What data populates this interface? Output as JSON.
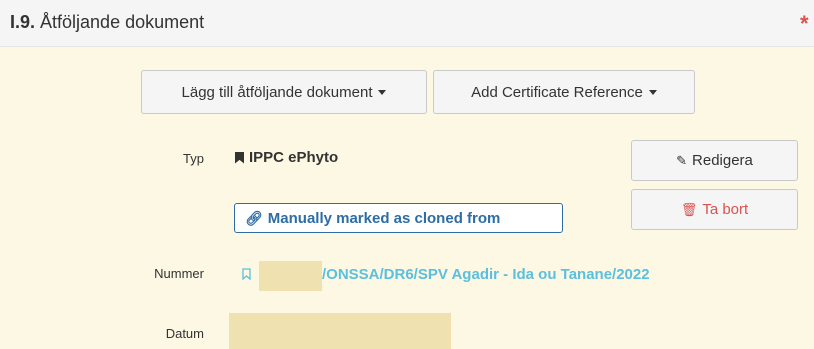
{
  "header": {
    "section_number": "I.9.",
    "section_title": " Åtföljande dokument",
    "required_marker": "*"
  },
  "toolbar": {
    "add_document_label": "Lägg till åtföljande dokument",
    "add_certificate_label": "Add Certificate Reference"
  },
  "document": {
    "type_label": "Typ",
    "type_value": "IPPC ePhyto",
    "cloned_badge": "Manually marked as cloned from",
    "edit_label": "Redigera",
    "delete_label": "Ta bort",
    "number_label": "Nummer",
    "number_value": "/ONSSA/DR6/SPV Agadir - Ida ou Tanane/2022",
    "date_label": "Datum"
  },
  "colors": {
    "panel_body": "#fcf8e3",
    "link": "#5bc0de",
    "badge": "#2e6da4",
    "danger": "#d9534f"
  },
  "icons": {
    "type": "bookmark-icon",
    "cloned": "link-icon",
    "edit": "edit-icon",
    "delete": "trash-icon",
    "number": "bookmark-outline-icon"
  }
}
